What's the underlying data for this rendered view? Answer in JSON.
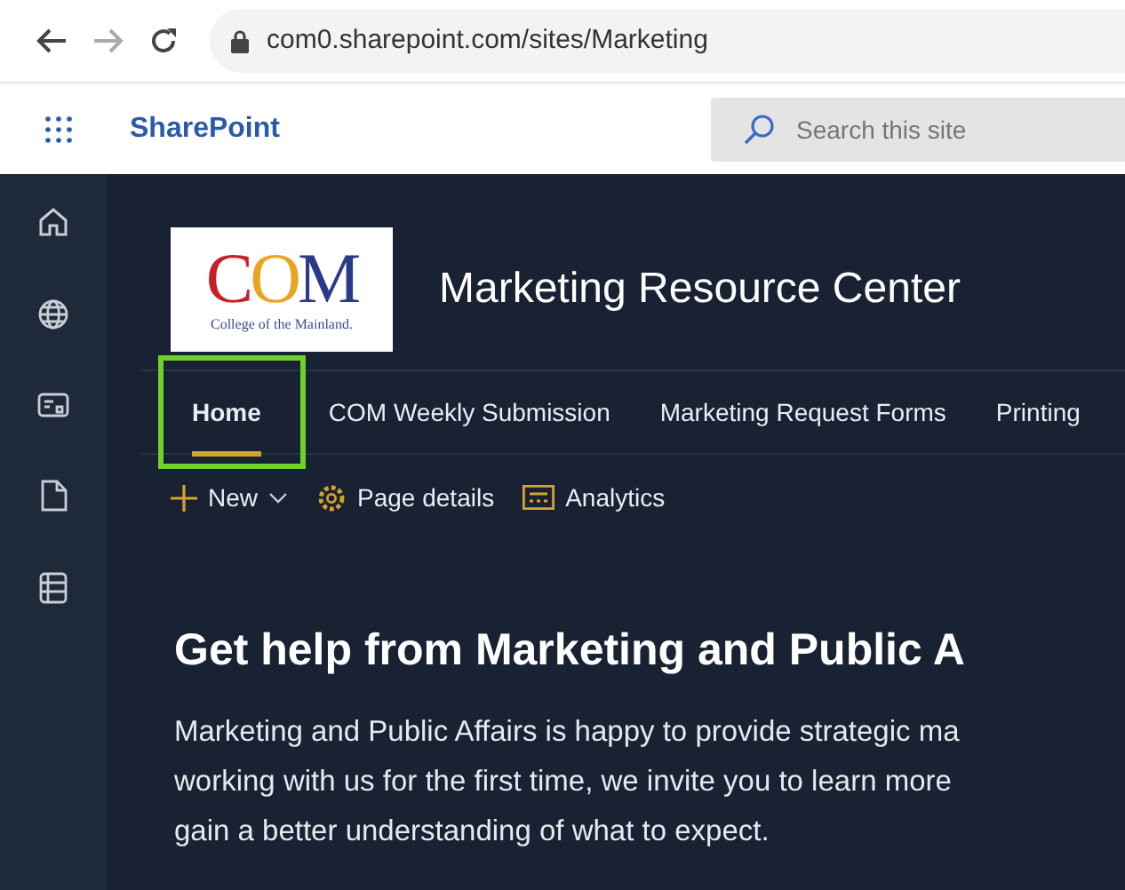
{
  "browser": {
    "url": "com0.sharepoint.com/sites/Marketing"
  },
  "suite_bar": {
    "app_name": "SharePoint",
    "search": {
      "placeholder": "Search this site"
    }
  },
  "site": {
    "logo": {
      "letters": "COM",
      "tagline": "College of the Mainland."
    },
    "title": "Marketing Resource Center"
  },
  "nav": [
    {
      "label": "Home",
      "selected": true,
      "outlined": true
    },
    {
      "label": "COM Weekly Submission",
      "selected": false,
      "outlined": false
    },
    {
      "label": "Marketing Request Forms",
      "selected": false,
      "outlined": false
    },
    {
      "label": "Printing",
      "selected": false,
      "outlined": false
    }
  ],
  "commands": [
    {
      "kind": "new",
      "label": "New"
    },
    {
      "kind": "details",
      "label": "Page details"
    },
    {
      "kind": "analytics",
      "label": "Analytics"
    }
  ],
  "content": {
    "heading": "Get help from Marketing and Public A",
    "paragraph_lines": [
      "Marketing and Public Affairs is happy to provide strategic ma",
      "working with us for the first time, we invite you to learn more",
      "gain a better understanding of what to expect."
    ]
  }
}
